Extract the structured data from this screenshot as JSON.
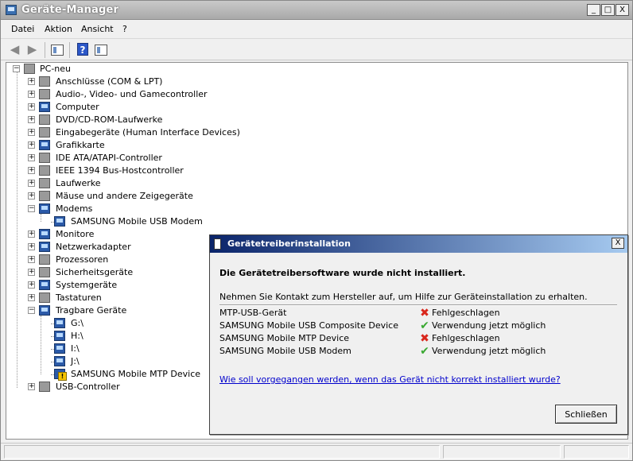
{
  "window": {
    "title": "Geräte-Manager"
  },
  "window_buttons": {
    "minimize": "_",
    "maximize": "□",
    "close": "X"
  },
  "menu": [
    "Datei",
    "Aktion",
    "Ansicht",
    "?"
  ],
  "toolbar": {
    "help_label": "?"
  },
  "tree": {
    "root": "PC-neu",
    "categories": [
      "Anschlüsse (COM & LPT)",
      "Audio-, Video- und Gamecontroller",
      "Computer",
      "DVD/CD-ROM-Laufwerke",
      "Eingabegeräte (Human Interface Devices)",
      "Grafikkarte",
      "IDE ATA/ATAPI-Controller",
      "IEEE 1394 Bus-Hostcontroller",
      "Laufwerke",
      "Mäuse und andere Zeigegeräte",
      "Modems",
      "Monitore",
      "Netzwerkadapter",
      "Prozessoren",
      "Sicherheitsgeräte",
      "Systemgeräte",
      "Tastaturen",
      "Tragbare Geräte",
      "USB-Controller"
    ],
    "modems_children": [
      "SAMSUNG Mobile USB Modem"
    ],
    "portable_children": [
      "G:\\",
      "H:\\",
      "I:\\",
      "J:\\",
      "SAMSUNG Mobile MTP Device"
    ],
    "expand_plus": "+",
    "expand_minus": "−"
  },
  "dialog": {
    "title": "Gerätetreiberinstallation",
    "close_label": "X",
    "heading": "Die Gerätetreibersoftware wurde nicht installiert.",
    "info": "Nehmen Sie Kontakt zum Hersteller auf, um Hilfe zur Geräteinstallation zu erhalten.",
    "devices": [
      {
        "name": "MTP-USB-Gerät",
        "status": "Fehlgeschlagen",
        "icon": "✖"
      },
      {
        "name": "SAMSUNG Mobile USB Composite Device",
        "status": "Verwendung jetzt möglich",
        "icon": "✔"
      },
      {
        "name": "SAMSUNG Mobile MTP Device",
        "status": "Fehlgeschlagen",
        "icon": "✖"
      },
      {
        "name": "SAMSUNG Mobile USB Modem",
        "status": "Verwendung jetzt möglich",
        "icon": "✔"
      }
    ],
    "link": "Wie soll vorgegangen werden, wenn das Gerät nicht korrekt installiert wurde?",
    "button": "Schließen"
  },
  "colors": {
    "fail": "#d9261c",
    "ok": "#3aa832",
    "link": "#0000cc",
    "dialog_title_start": "#0a246a",
    "dialog_title_end": "#a6caf0"
  }
}
